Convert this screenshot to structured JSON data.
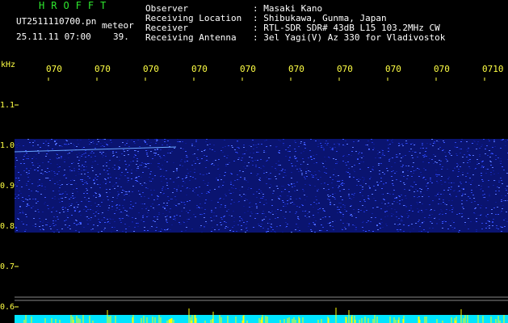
{
  "header": {
    "app_title": "HROFFT",
    "file_name": "UT2511110700.pn",
    "meteor_label": "meteor",
    "datetime": "25.11.11 07:00",
    "count": "39."
  },
  "info": [
    {
      "key": "Observer",
      "value": ": Masaki Kano"
    },
    {
      "key": "Receiving Location",
      "value": ": Shibukawa, Gunma, Japan"
    },
    {
      "key": "Receiver",
      "value": ": RTL-SDR SDR# 43dB L15 103.2MHz CW"
    },
    {
      "key": "Receiving Antenna",
      "value": ": 3el Yagi(V) Az 330 for Vladivostok"
    }
  ],
  "x_axis": {
    "tick_labels": [
      "070",
      "070",
      "070",
      "070",
      "070",
      "070",
      "070",
      "070",
      "070",
      "0710"
    ]
  },
  "y_axis": {
    "unit": "kHz",
    "tick_labels": [
      "1.1",
      "1.0",
      "0.9",
      "0.8",
      "0.7",
      "0.6"
    ]
  },
  "colors": {
    "title": "#2ee82e",
    "text": "#ffffff",
    "axis": "#ffff44",
    "signal": "#2244dd",
    "baseline": "#00e5ff",
    "spikes": "#ffff00"
  }
}
